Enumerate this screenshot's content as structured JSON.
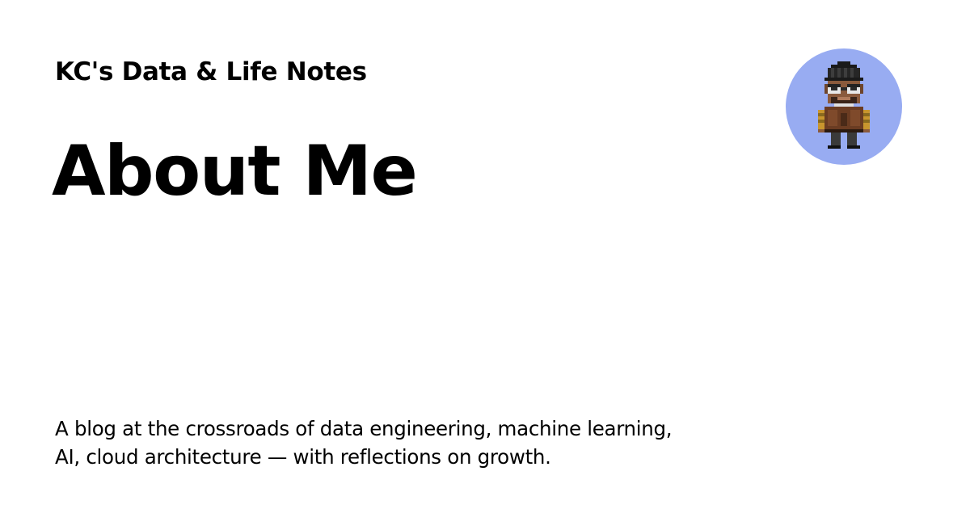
{
  "header": {
    "site_title": "KC's Data & Life Notes"
  },
  "main": {
    "page_title": "About Me",
    "description_lines": [
      "A blog at the crossroads of data engineering, machine learning,",
      "AI, cloud architecture — with reflections on growth."
    ]
  },
  "avatar": {
    "icon": "pixel-character-icon",
    "background_color": "#98acf2"
  },
  "colors": {
    "background": "#ffffff",
    "text": "#000000"
  }
}
